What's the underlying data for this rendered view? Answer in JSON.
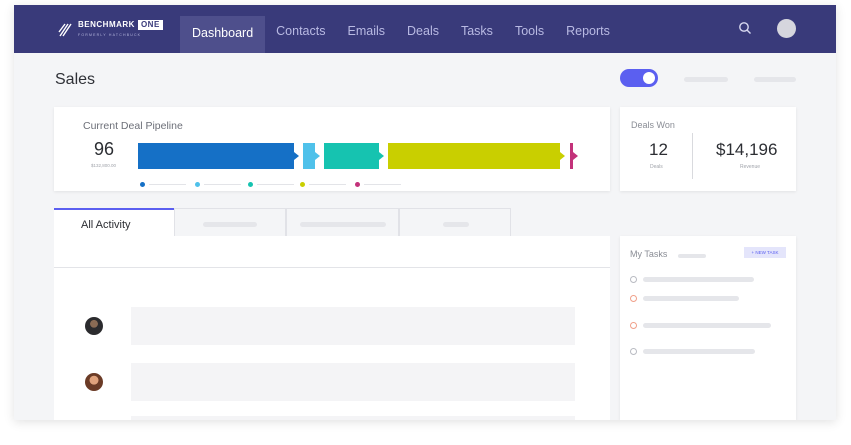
{
  "app": {
    "logo_text": "BENCHMARK",
    "logo_badge": "ONE",
    "logo_sub": "FORMERLY HATCHBUCK"
  },
  "nav": {
    "items": [
      {
        "label": "Dashboard",
        "active": true
      },
      {
        "label": "Contacts"
      },
      {
        "label": "Emails"
      },
      {
        "label": "Deals"
      },
      {
        "label": "Tasks"
      },
      {
        "label": "Tools"
      },
      {
        "label": "Reports"
      }
    ],
    "search_icon": "search-icon",
    "avatar": "user-avatar"
  },
  "page": {
    "title": "Sales",
    "toggle_on": true
  },
  "pipeline": {
    "label": "Current Deal Pipeline",
    "count": "96",
    "sub": "$132,800.00",
    "stage_colors": [
      "#1570c6",
      "#4fc1ea",
      "#16c3b0",
      "#c9cf00",
      "#c3327a"
    ]
  },
  "deals_won": {
    "label": "Deals Won",
    "count": "12",
    "count_label": "Deals",
    "revenue": "$14,196",
    "revenue_label": "Revenue"
  },
  "activity": {
    "tabs": [
      {
        "label": "All Activity",
        "active": true
      },
      {
        "label": ""
      },
      {
        "label": ""
      },
      {
        "label": ""
      }
    ]
  },
  "tasks": {
    "label": "My Tasks",
    "new_task_label": "+ NEW TASK"
  },
  "colors": {
    "topbar": "#393a7a",
    "accent": "#5b5ff0"
  }
}
